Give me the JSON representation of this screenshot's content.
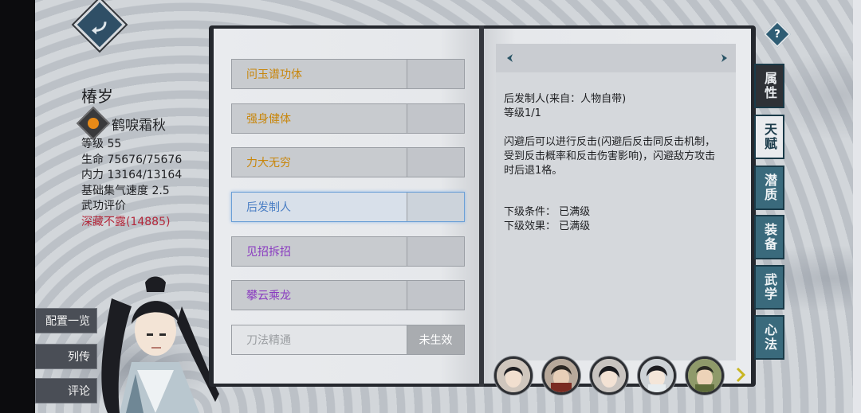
{
  "character": {
    "name": "椿岁",
    "title": "鹤唳霜秋",
    "stats": [
      "等级 55",
      "生命 75676/75676",
      "内力 13164/13164",
      "基础集气速度 2.5",
      "武功评价"
    ],
    "rating": "深藏不露(14885)"
  },
  "left_menu": [
    "配置一览",
    "列传",
    "评论"
  ],
  "talents": [
    {
      "name": "问玉谱功体",
      "slot": "",
      "color": "gold"
    },
    {
      "name": "强身健体",
      "slot": "",
      "color": "gold"
    },
    {
      "name": "力大无穷",
      "slot": "",
      "color": "gold"
    },
    {
      "name": "后发制人",
      "slot": "",
      "color": "blue"
    },
    {
      "name": "见招拆招",
      "slot": "",
      "color": "purple"
    },
    {
      "name": "攀云乘龙",
      "slot": "",
      "color": "purple"
    },
    {
      "name": "刀法精通",
      "slot": "未生效",
      "color": "gray"
    }
  ],
  "detail": {
    "title": "后发制人(来自：人物自带)",
    "level": "等级1/1",
    "description": [
      "闪避后可以进行反击(闪避后反击同反击机制，",
      "受到反击概率和反击伤害影响)，闪避敌方攻击",
      "时后退1格。"
    ],
    "next_condition": "下级条件：  已满级",
    "next_effect": "下级效果：  已满级"
  },
  "tabs": [
    "属性",
    "天赋",
    "潜质",
    "装备",
    "武学",
    "心法"
  ],
  "help_label": "?",
  "colors": {
    "gold": "#c8860b",
    "blue": "#4a7ec4",
    "purple": "#8a3bc0",
    "tab": "#3a6a7c"
  }
}
